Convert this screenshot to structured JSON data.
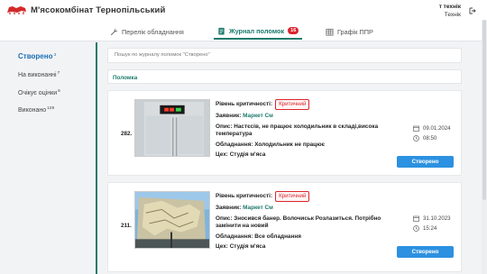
{
  "header": {
    "brand": "М'ясокомбінат Тернопільський",
    "user_role": "т технік",
    "user_name": "Технік"
  },
  "tabs": [
    {
      "label": "Перелік обладнання",
      "icon": "wrench-icon",
      "active": false
    },
    {
      "label": "Журнал поломок",
      "icon": "journal-icon",
      "active": true,
      "badge": "16"
    },
    {
      "label": "Графік ППР",
      "icon": "calendar-grid-icon",
      "active": false
    }
  ],
  "sidebar": {
    "items": [
      {
        "label": "Створено",
        "count": "3",
        "active": true
      },
      {
        "label": "На виконанні",
        "count": "7",
        "active": false
      },
      {
        "label": "Очікує оцінки",
        "count": "6",
        "active": false
      },
      {
        "label": "Виконано",
        "count": "129",
        "active": false
      }
    ]
  },
  "search": {
    "placeholder": "Пошук по журналу поломок \"Створено\""
  },
  "section_title": "Поломка",
  "labels": {
    "criticality": "Рівень критичності:",
    "requester": "Заявник:",
    "description": "Опис:",
    "equipment": "Обладнання:",
    "shop": "Цех:"
  },
  "cards": [
    {
      "number": "282.",
      "criticality": "Критичний",
      "requester": "Маркет См",
      "description": "Настєсів, не працює холодильник в складі,висока температура",
      "equipment": "Холодильник не працює",
      "shop": "Студія м'яса",
      "date": "09.01.2024",
      "time": "08:50",
      "status": "Створено"
    },
    {
      "number": "211.",
      "criticality": "Критичний",
      "requester": "Маркет См",
      "description": "Зносився банер. Волочиськ Розлазиться. Потрібно замінити на новий",
      "equipment": "Все обладнання",
      "shop": "Студія м'яса",
      "date": "31.10.2023",
      "time": "15:24",
      "status": "Створено"
    }
  ],
  "colors": {
    "accent": "#1d7a6c",
    "badge": "#d9262e",
    "button": "#2c91e0",
    "active_sidebar": "#1b6fb5"
  }
}
